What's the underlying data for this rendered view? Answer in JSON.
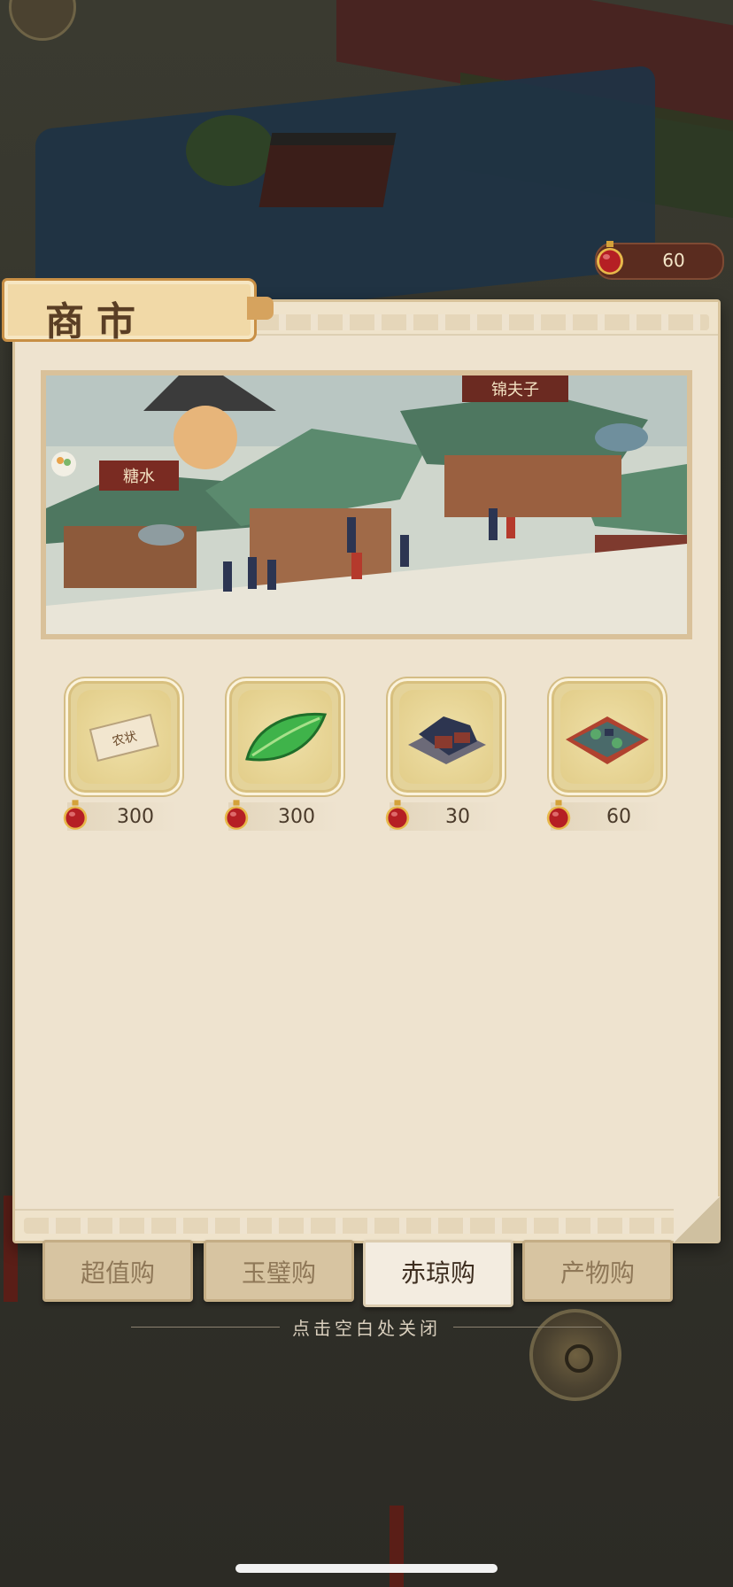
{
  "hud": {
    "currency_value": "60",
    "currency_icon": "red-jade-gem-icon"
  },
  "panel": {
    "title": "商市"
  },
  "banner": {
    "shop_sign_left": "糖水",
    "shop_sign_right": "锦夫子"
  },
  "items": [
    {
      "icon": "license-scroll-icon",
      "scroll_text": "农状",
      "price": "300",
      "price_icon": "red-jade-gem-icon"
    },
    {
      "icon": "green-leaf-icon",
      "price": "300",
      "price_icon": "red-jade-gem-icon"
    },
    {
      "icon": "courtyard-building-icon",
      "price": "30",
      "price_icon": "red-jade-gem-icon"
    },
    {
      "icon": "garden-courtyard-icon",
      "price": "60",
      "price_icon": "red-jade-gem-icon"
    }
  ],
  "tabs": [
    {
      "label": "超值购",
      "active": false
    },
    {
      "label": "玉璧购",
      "active": false
    },
    {
      "label": "赤琼购",
      "active": true
    },
    {
      "label": "产物购",
      "active": false
    }
  ],
  "close_hint": "点击空白处关闭",
  "colors": {
    "panel_bg": "#eee3cf",
    "tile_gold": "#e4d39a",
    "gem_red": "#c2282a",
    "title_brown": "#5a3e25"
  }
}
